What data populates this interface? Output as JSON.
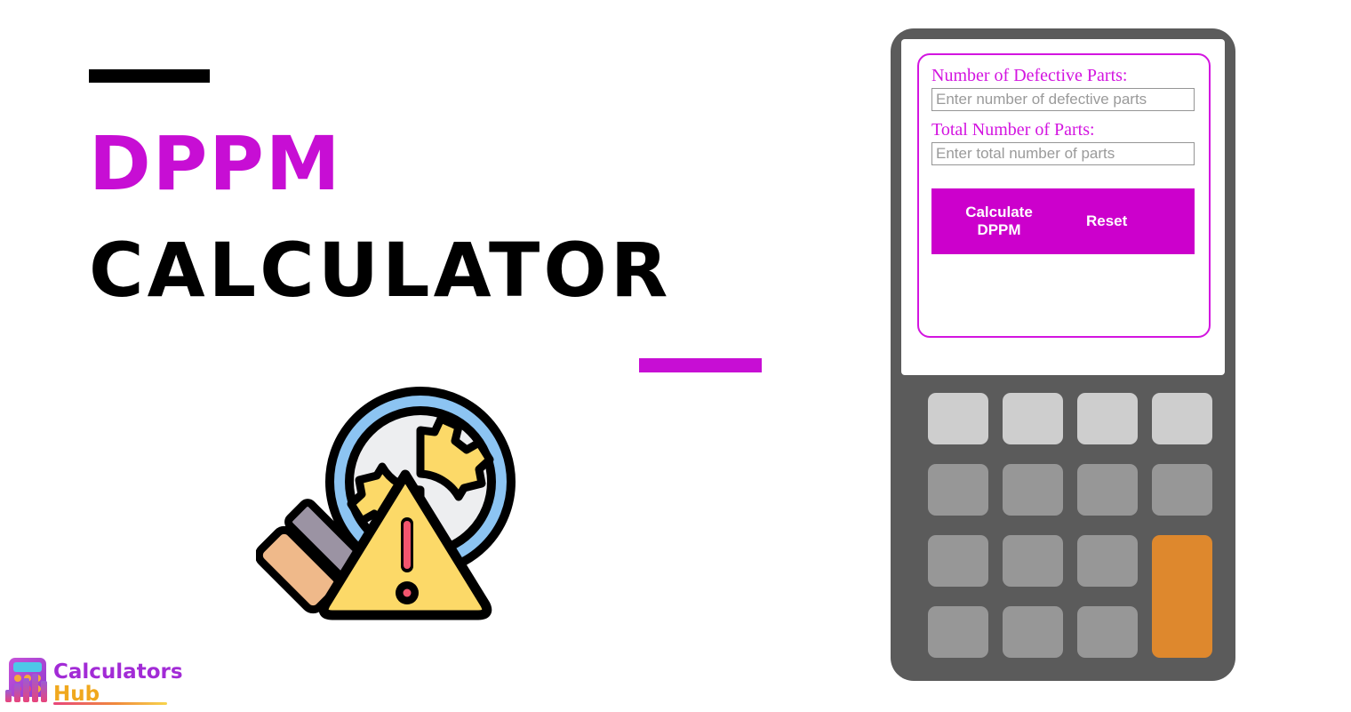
{
  "hero": {
    "title_line1": "DPPM",
    "title_line2": "CALCULATOR",
    "accent_bar_black": "decorative-black-rule",
    "accent_bar_magenta": "decorative-magenta-rule",
    "illustration_name": "magnifying-glass-gear-warning-illustration"
  },
  "logo": {
    "word_primary": "Calculators",
    "word_secondary": "Hub",
    "primary_color": "#A22BD6",
    "secondary_color": "#F0A81E"
  },
  "colors": {
    "magenta": "#CC00CC",
    "magenta_border": "#D315E0",
    "title_magenta": "#C70ED4",
    "body_gray": "#5B5B5B",
    "key_light": "#CECECE",
    "key_mid": "#979797",
    "key_accent_orange": "#DE882D",
    "black": "#000000",
    "white": "#FFFFFF"
  },
  "calculator": {
    "form": {
      "fields": [
        {
          "label": "Number of Defective Parts:",
          "placeholder": "Enter number of defective parts",
          "value": ""
        },
        {
          "label": "Total Number of Parts:",
          "placeholder": "Enter total number of parts",
          "value": ""
        }
      ],
      "calculate_label": "Calculate DPPM",
      "reset_label": "Reset"
    },
    "keypad": {
      "rows": [
        [
          {
            "name": "key-r1c1",
            "style": "light"
          },
          {
            "name": "key-r1c2",
            "style": "light"
          },
          {
            "name": "key-r1c3",
            "style": "light"
          },
          {
            "name": "key-r1c4",
            "style": "light"
          }
        ],
        [
          {
            "name": "key-r2c1",
            "style": "mid"
          },
          {
            "name": "key-r2c2",
            "style": "mid"
          },
          {
            "name": "key-r2c3",
            "style": "mid"
          },
          {
            "name": "key-r2c4",
            "style": "mid"
          }
        ],
        [
          {
            "name": "key-r3c1",
            "style": "mid"
          },
          {
            "name": "key-r3c2",
            "style": "mid"
          },
          {
            "name": "key-r3c3",
            "style": "mid"
          },
          {
            "name": "key-equals",
            "style": "accent"
          }
        ],
        [
          {
            "name": "key-r4c1",
            "style": "mid"
          },
          {
            "name": "key-r4c2",
            "style": "mid"
          },
          {
            "name": "key-r4c3",
            "style": "mid"
          }
        ]
      ]
    }
  }
}
